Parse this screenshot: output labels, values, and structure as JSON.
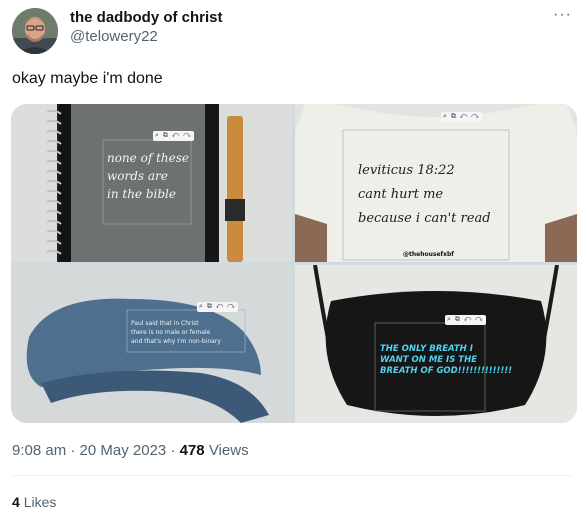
{
  "author": {
    "display_name": "the dadbody of christ",
    "handle": "@telowery22",
    "more_icon": "···"
  },
  "tweet": {
    "text": "okay maybe i'm done"
  },
  "media": {
    "toolbar_icons": "⌕ ⧉ ↶ ↷",
    "notebook_text": "none of these\nwords are\nin the bible",
    "shirt_text": "leviticus 18:22\ncant hurt me\nbecause i can't read",
    "shirt_watermark": "@thehousefxbf",
    "visor_text": "Paul said that in Christ\nthere is no male or female\nand that's why I'm non-binary",
    "mask_text": "THE ONLY BREATH I\nWANT ON ME IS THE\nBREATH OF GOD!!!!!!!!!!!!!!"
  },
  "meta": {
    "time": "9:08 am",
    "sep1": "·",
    "date": "20 May 2023",
    "sep2": "·",
    "views_count": "478",
    "views_label": "Views"
  },
  "stats": {
    "likes_count": "4",
    "likes_label": "Likes"
  }
}
